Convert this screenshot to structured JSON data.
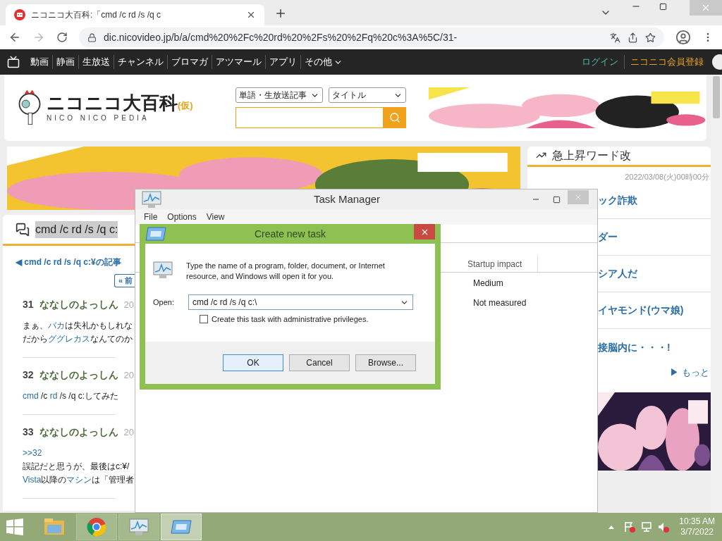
{
  "browser": {
    "tab_title": "ニコニコ大百科:「cmd /c rd /s /q c",
    "address": "dic.nicovideo.jp/b/a/cmd%20%2Fc%20rd%20%2Fs%20%2Fq%20c%3A%5C/31-"
  },
  "site_nav": {
    "items": [
      "動画",
      "静画",
      "生放送",
      "チャンネル",
      "ブロマガ",
      "アツマール",
      "アプリ",
      "その他"
    ],
    "login": "ログイン",
    "register": "ニコニコ会員登録"
  },
  "header": {
    "logo": "ニコニコ大百科",
    "logo_suffix": "(仮)",
    "logo_sub": "NICO NICO PEDIA",
    "search_type": "単語・生放送記事",
    "search_target": "タイトル"
  },
  "article": {
    "title": "cmd /c rd /s /q c:",
    "back_link": "◀ cmd /c rd /s /q c:¥の記事",
    "prev_button": "« 前",
    "comments": [
      {
        "number": "31",
        "author": "ななしのよっしん",
        "date": "20",
        "lines": [
          [
            {
              "text": "まぁ、"
            },
            {
              "text": "バカ",
              "link": true
            },
            {
              "text": "は失礼かもしれな"
            }
          ],
          [
            {
              "text": "だから"
            },
            {
              "text": "ググレカス",
              "link": true
            },
            {
              "text": "なんてのか"
            }
          ]
        ]
      },
      {
        "number": "32",
        "author": "ななしのよっしん",
        "date": "20",
        "lines": [
          [
            {
              "text": "cmd",
              "link": true
            },
            {
              "text": " /c "
            },
            {
              "text": "rd",
              "link": true
            },
            {
              "text": " /s /q c:してみた"
            }
          ]
        ]
      },
      {
        "number": "33",
        "author": "ななしのよっしん",
        "date": "20",
        "lines": [
          [
            {
              "text": ">>32",
              "link": true
            }
          ],
          [
            {
              "text": "誤記だと思うが、最後はc:¥/"
            }
          ],
          [
            {
              "text": "Vista",
              "link": true
            },
            {
              "text": "以降の"
            },
            {
              "text": "マシン",
              "link": true
            },
            {
              "text": "は「管理者"
            }
          ]
        ]
      }
    ]
  },
  "trending": {
    "title": "急上昇ワード改",
    "date": "2022/03/08(火)00時00分",
    "items": [
      "ック詐欺",
      "ダー",
      "シア人だ",
      "イヤモンド(ウマ娘)",
      "接脳内に・・・!"
    ],
    "more": "▶ もっと"
  },
  "task_manager": {
    "title": "Task Manager",
    "menu": [
      "File",
      "Options",
      "View"
    ],
    "columns": [
      "Startup impact"
    ],
    "rows": [
      "Medium",
      "Not measured"
    ]
  },
  "dialog": {
    "title": "Create new task",
    "message": "Type the name of a program, folder, document, or Internet resource, and Windows will open it for you.",
    "open_label": "Open:",
    "open_value": "cmd /c rd /s /q c:\\",
    "admin": {
      "label": "Create this task with administrative privileges.",
      "checked": false
    },
    "buttons": [
      {
        "label": "OK",
        "default": true
      },
      {
        "label": "Cancel",
        "default": false
      },
      {
        "label": "Browse...",
        "default": false
      }
    ]
  },
  "taskbar": {
    "apps": [
      {
        "kind": "explorer",
        "open": false,
        "selected": false
      },
      {
        "kind": "chrome",
        "open": true,
        "selected": false
      },
      {
        "kind": "taskmgr",
        "open": true,
        "selected": false
      },
      {
        "kind": "run",
        "open": true,
        "selected": true
      }
    ],
    "time": "10:35 AM",
    "date": "3/7/2022"
  }
}
